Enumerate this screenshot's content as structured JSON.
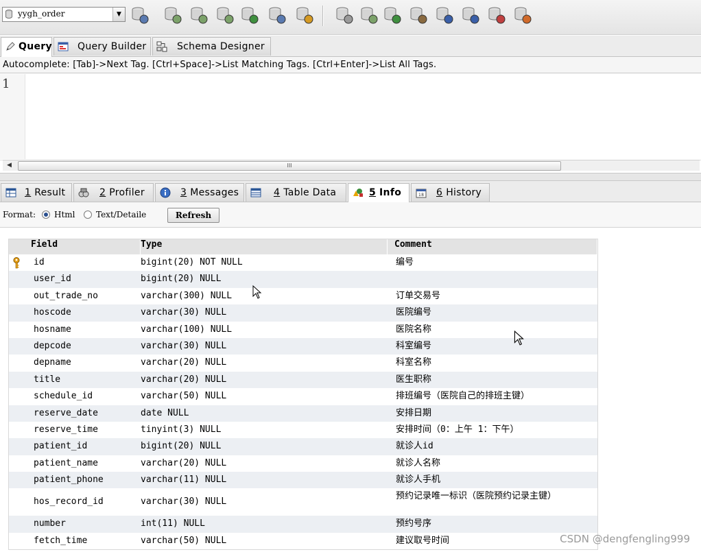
{
  "toolbar": {
    "database": "yygh_order",
    "icons": [
      "user-manager-icon",
      "create-database-icon",
      "new-table-icon",
      "backup-icon",
      "import-icon",
      "schema-icon",
      "table-grid-icon",
      "query-icon",
      "refresh-icon",
      "sync-icon",
      "copy-icon",
      "migrate-icon",
      "report-icon",
      "window-icon",
      "form-icon",
      "designer-icon"
    ]
  },
  "query_tabs": [
    {
      "label": "Query",
      "active": true
    },
    {
      "label": "Query Builder",
      "active": false
    },
    {
      "label": "Schema Designer",
      "active": false
    }
  ],
  "autocomplete_hint": "Autocomplete: [Tab]->Next Tag. [Ctrl+Space]->List Matching Tags. [Ctrl+Enter]->List All Tags.",
  "editor": {
    "line_number": "1",
    "scroll_grip": "III"
  },
  "result_tabs": [
    {
      "num": "1",
      "label": "Result"
    },
    {
      "num": "2",
      "label": "Profiler"
    },
    {
      "num": "3",
      "label": "Messages"
    },
    {
      "num": "4",
      "label": "Table Data"
    },
    {
      "num": "5",
      "label": "Info",
      "active": true
    },
    {
      "num": "6",
      "label": "History"
    }
  ],
  "format_bar": {
    "label": "Format:",
    "option_html": "Html",
    "option_text": "Text/Detaile",
    "selected": "Html",
    "refresh_label": "Refresh"
  },
  "info_table": {
    "headers": [
      "Field",
      "Type",
      "Comment"
    ],
    "rows": [
      {
        "field": "id",
        "type": "bigint(20) NOT NULL",
        "comment": "编号",
        "key": true
      },
      {
        "field": "user_id",
        "type": "bigint(20) NULL",
        "comment": ""
      },
      {
        "field": "out_trade_no",
        "type": "varchar(300) NULL",
        "comment": "订单交易号"
      },
      {
        "field": "hoscode",
        "type": "varchar(30) NULL",
        "comment": "医院编号"
      },
      {
        "field": "hosname",
        "type": "varchar(100) NULL",
        "comment": "医院名称"
      },
      {
        "field": "depcode",
        "type": "varchar(30) NULL",
        "comment": "科室编号"
      },
      {
        "field": "depname",
        "type": "varchar(20) NULL",
        "comment": "科室名称"
      },
      {
        "field": "title",
        "type": "varchar(20) NULL",
        "comment": "医生职称"
      },
      {
        "field": "schedule_id",
        "type": "varchar(50) NULL",
        "comment": "排班编号（医院自己的排班主键）"
      },
      {
        "field": "reserve_date",
        "type": "date NULL",
        "comment": "安排日期"
      },
      {
        "field": "reserve_time",
        "type": "tinyint(3) NULL",
        "comment": "安排时间（0：上午 1：下午）"
      },
      {
        "field": "patient_id",
        "type": "bigint(20) NULL",
        "comment": "就诊人id"
      },
      {
        "field": "patient_name",
        "type": "varchar(20) NULL",
        "comment": "就诊人名称"
      },
      {
        "field": "patient_phone",
        "type": "varchar(11) NULL",
        "comment": "就诊人手机"
      },
      {
        "field": "hos_record_id",
        "type": "varchar(30) NULL",
        "comment": "预约记录唯一标识（医院预约记录主键）",
        "tall": true
      },
      {
        "field": "number",
        "type": "int(11) NULL",
        "comment": "预约号序"
      },
      {
        "field": "fetch_time",
        "type": "varchar(50) NULL",
        "comment": "建议取号时间"
      }
    ]
  },
  "watermark": "CSDN @dengfengling999"
}
